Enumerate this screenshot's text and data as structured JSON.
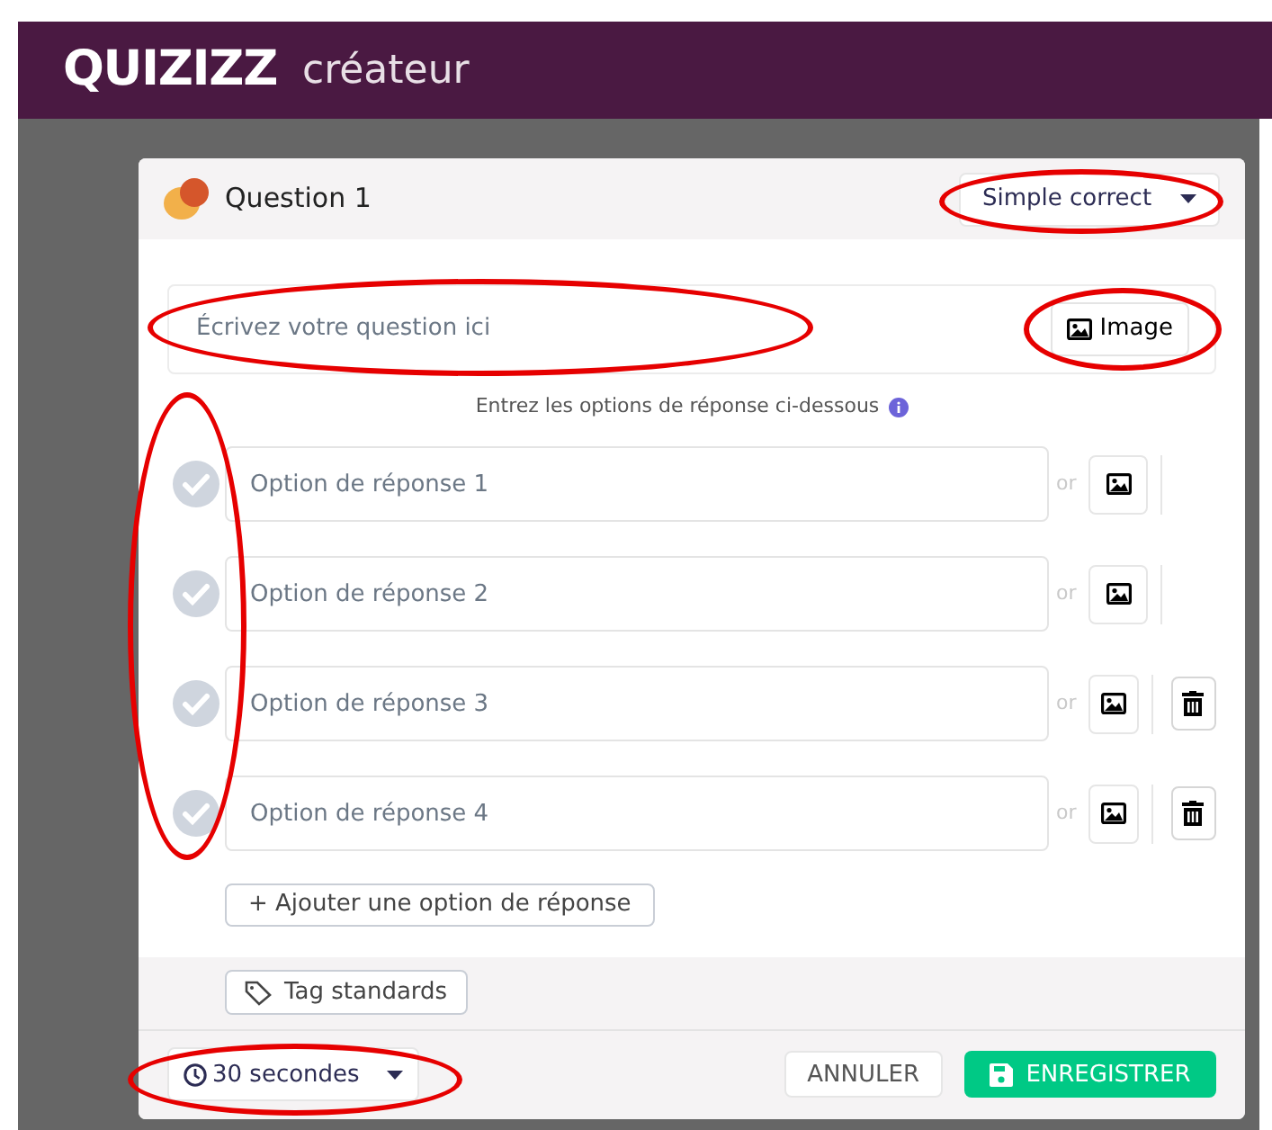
{
  "header": {
    "logo": "QUIZIZZ",
    "title": "créateur"
  },
  "question": {
    "title": "Question 1",
    "type": {
      "value": "Simple correct",
      "circled": true
    },
    "field": {
      "placeholder": "Écrivez votre question ici",
      "circled": true
    },
    "image_button": {
      "label": "Image",
      "circled": true
    }
  },
  "hint": "Entrez les options de réponse ci-dessous",
  "answers": {
    "circled": true,
    "items": [
      {
        "placeholder": "Option de réponse 1",
        "correct": false,
        "or": "or",
        "deletable": false
      },
      {
        "placeholder": "Option de réponse 2",
        "correct": false,
        "or": "or",
        "deletable": false
      },
      {
        "placeholder": "Option de réponse 3",
        "correct": false,
        "or": "or",
        "deletable": true
      },
      {
        "placeholder": "Option de réponse 4",
        "correct": false,
        "or": "or",
        "deletable": true
      }
    ]
  },
  "add_option": "+ Ajouter une option de réponse",
  "tag_button": "Tag standards",
  "footer": {
    "timer": {
      "value": "30 secondes",
      "circled": true
    },
    "cancel": "ANNULER",
    "save": "ENREGISTRER"
  }
}
